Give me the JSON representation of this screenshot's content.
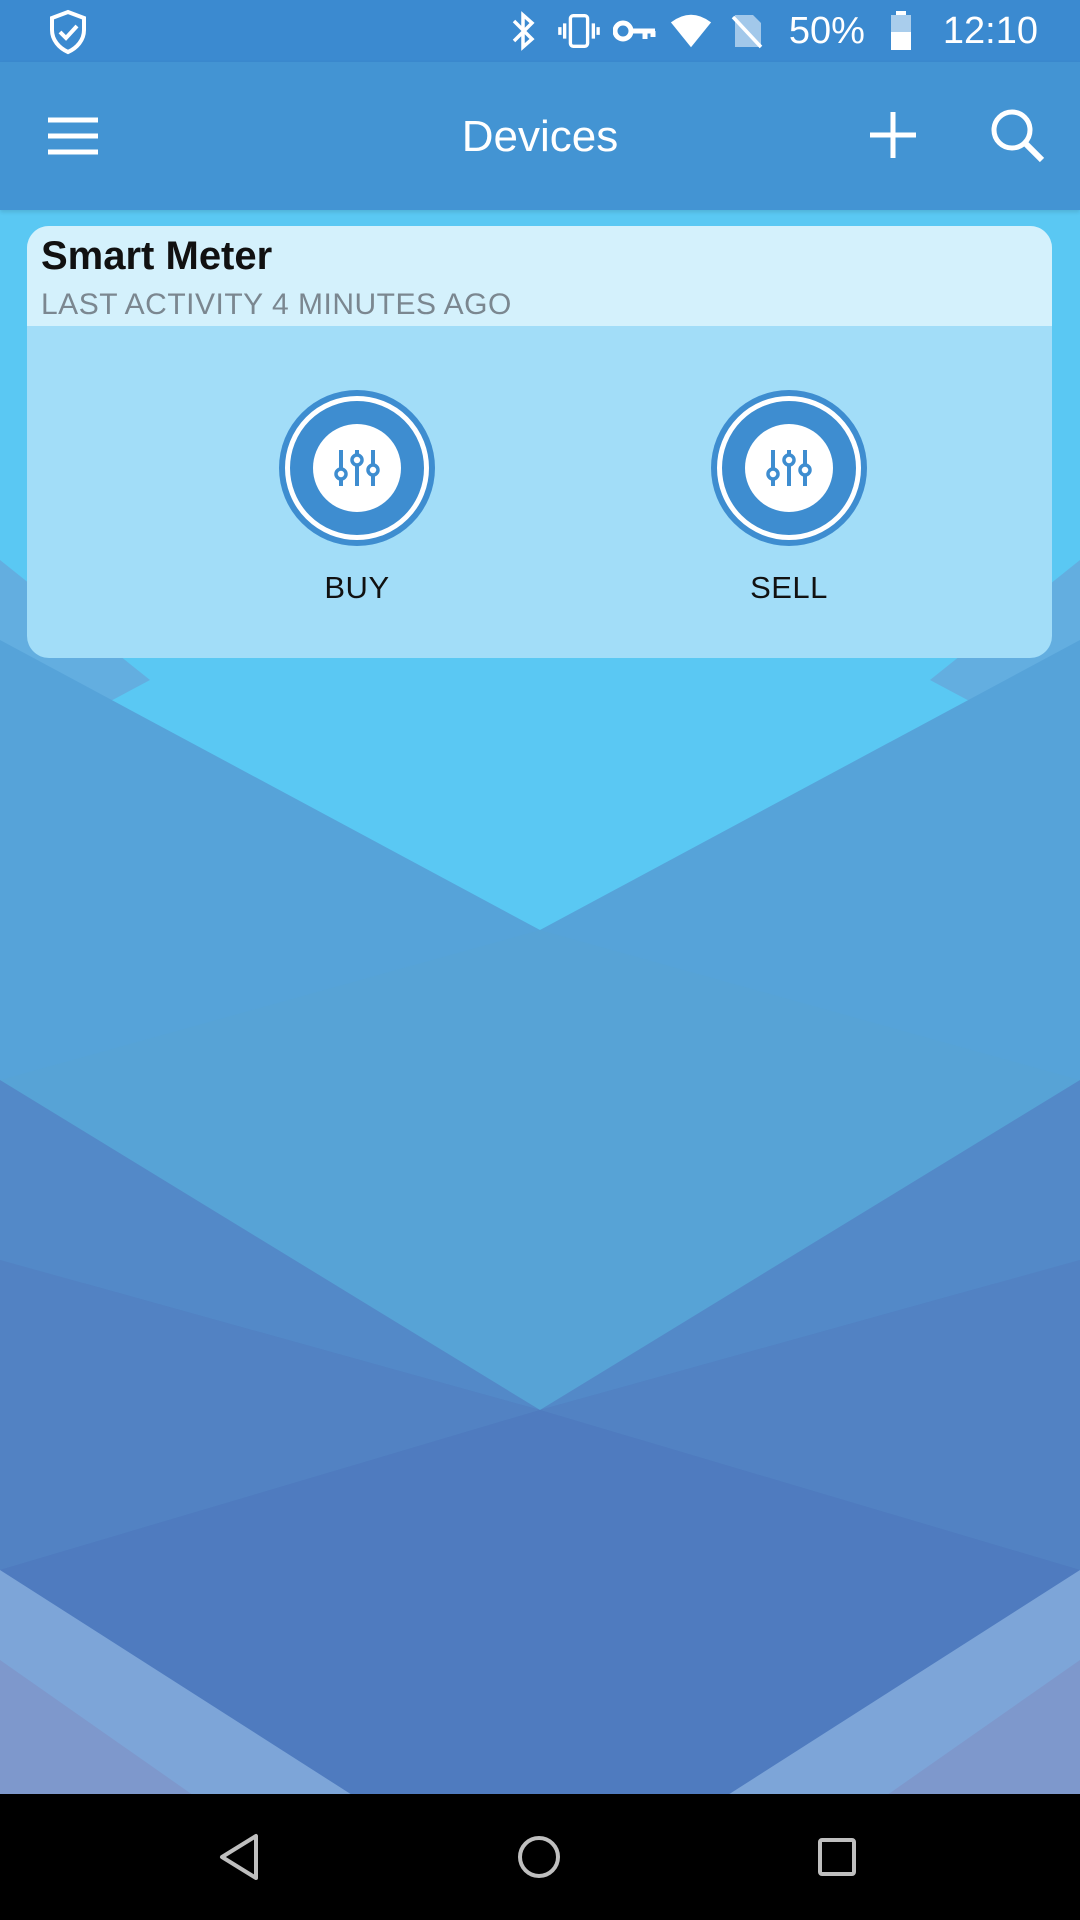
{
  "status_bar": {
    "battery_percent": "50%",
    "time": "12:10",
    "icons": [
      "shield-check-icon",
      "bluetooth-icon",
      "vibrate-icon",
      "vpn-key-icon",
      "wifi-icon",
      "no-sim-icon",
      "battery-icon"
    ]
  },
  "app_bar": {
    "title": "Devices",
    "icons": [
      "menu-icon",
      "add-icon",
      "search-icon"
    ]
  },
  "device_card": {
    "name": "Smart Meter",
    "last_activity": "LAST ACTIVITY 4 MINUTES AGO",
    "actions": [
      {
        "label": "BUY",
        "icon": "sliders-icon"
      },
      {
        "label": "SELL",
        "icon": "sliders-icon"
      }
    ]
  },
  "nav_bar": {
    "icons": [
      "back-icon",
      "home-icon",
      "recent-apps-icon"
    ]
  },
  "colors": {
    "status_bar": "#3b8ad0",
    "app_bar": "#4394d3",
    "card_header": "#d4f1fc",
    "card_body": "#a2ddf8",
    "accent": "#3e8dd0"
  }
}
